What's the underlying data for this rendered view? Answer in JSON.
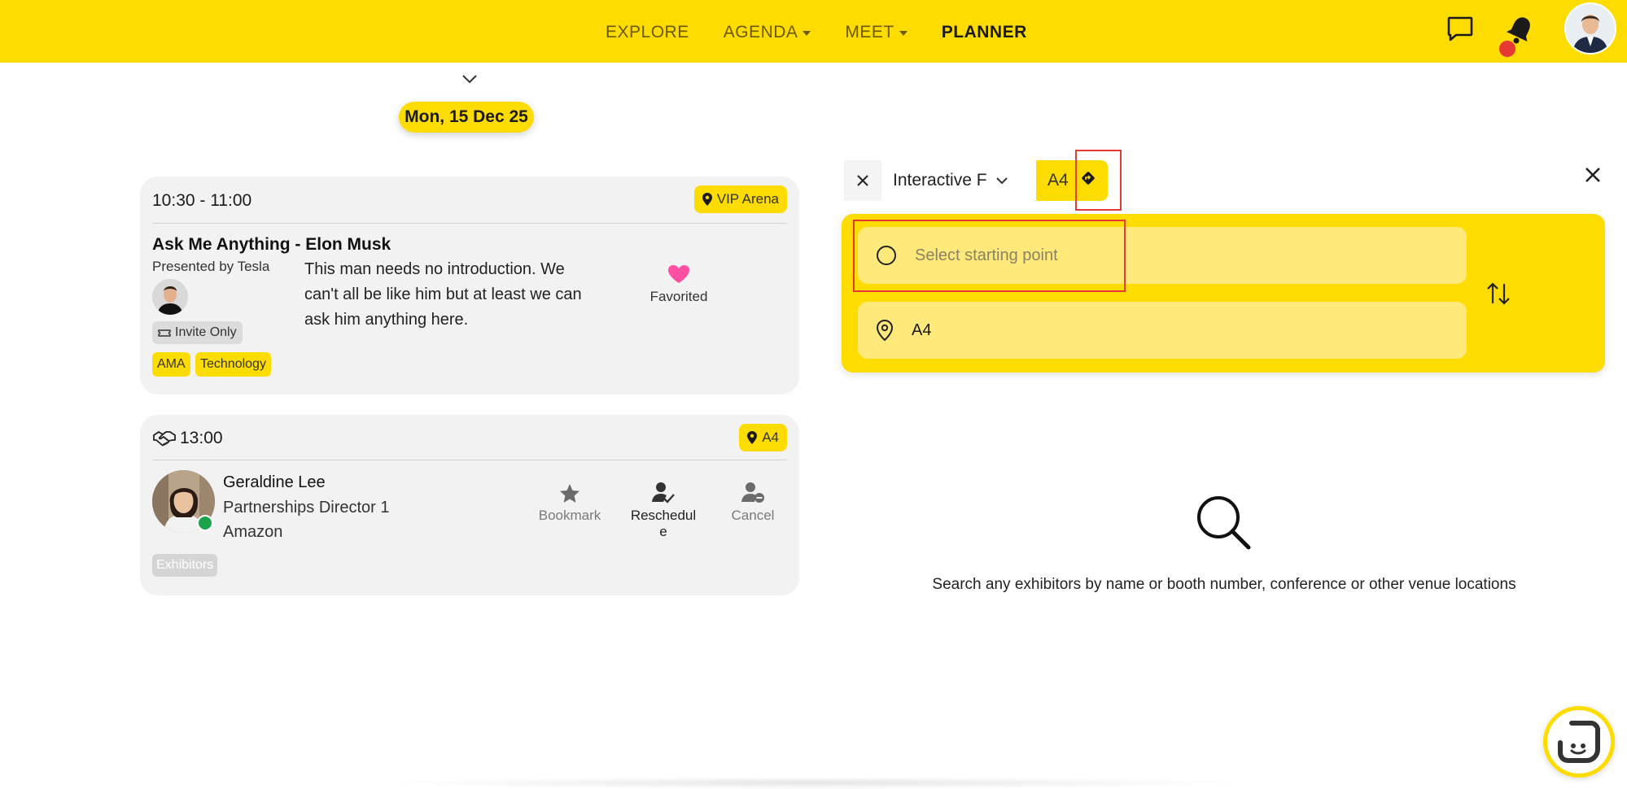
{
  "nav": {
    "items": [
      {
        "label": "EXPLORE",
        "dropdown": false
      },
      {
        "label": "AGENDA",
        "dropdown": true
      },
      {
        "label": "MEET",
        "dropdown": true
      },
      {
        "label": "PLANNER",
        "dropdown": false
      }
    ],
    "active": "PLANNER"
  },
  "date": "Mon, 15 Dec 25",
  "sessions": [
    {
      "time": "10:30 - 11:00",
      "location": "VIP Arena",
      "title": "Ask Me Anything - Elon Musk",
      "presenter": "Presented by Tesla",
      "description": "This man needs no introduction. We can't all be like him but at least we can ask him anything here.",
      "favorite_label": "Favorited",
      "access": "Invite Only",
      "tags": [
        "AMA",
        "Technology"
      ]
    }
  ],
  "meeting": {
    "time": "13:00",
    "location": "A4",
    "name": "Geraldine Lee",
    "role": "Partnerships Director 1",
    "company": "Amazon",
    "actions": [
      "Bookmark",
      "Reschedule",
      "Cancel"
    ],
    "tag": "Exhibitors"
  },
  "map": {
    "floor_select": "Interactive F",
    "destination_chip": "A4",
    "start_placeholder": "Select starting point",
    "end_value": "A4",
    "search_hint": "Search any exhibitors by name or booth number, conference or other venue locations"
  },
  "colors": {
    "brand_yellow": "#ffdc00",
    "favorite_pink": "#ff4fa3",
    "online_green": "#1aa34a",
    "alert_red": "#e53935"
  }
}
